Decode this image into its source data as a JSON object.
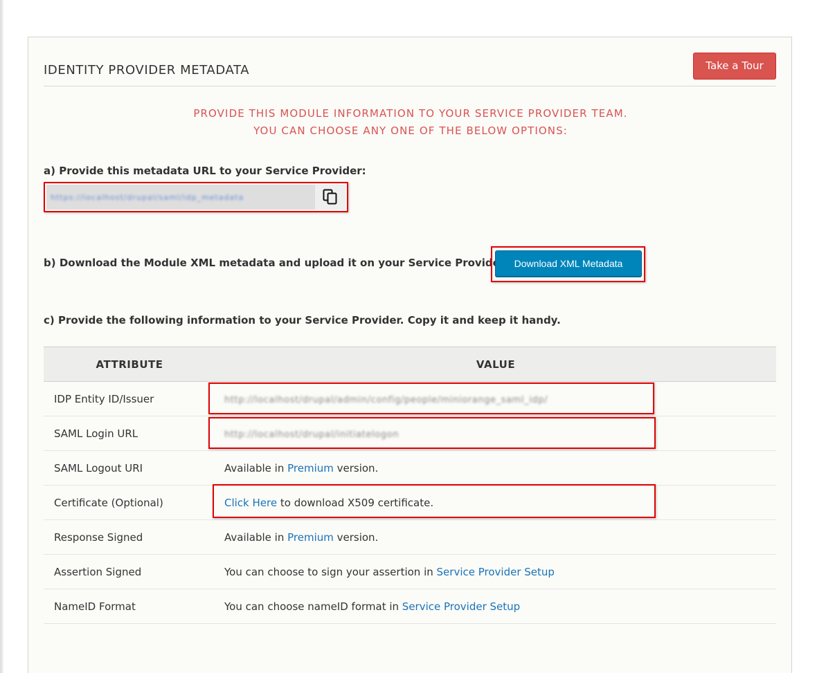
{
  "panel": {
    "title": "IDENTITY PROVIDER METADATA",
    "tour_button": "Take a Tour"
  },
  "notice": {
    "line1": "PROVIDE THIS MODULE INFORMATION TO YOUR SERVICE PROVIDER TEAM.",
    "line2": "YOU CAN CHOOSE ANY ONE OF THE BELOW OPTIONS:"
  },
  "option_a": {
    "label": "a) Provide this metadata URL to your Service Provider:",
    "url_value": "https://localhost/drupal/saml/idp_metadata",
    "copy_icon": "copy-icon"
  },
  "option_b": {
    "label": "b) Download the Module XML metadata and upload it on your Service Provider :",
    "button": "Download XML Metadata"
  },
  "option_c": {
    "label": "c) Provide the following information to your Service Provider. Copy it and keep it handy."
  },
  "table": {
    "headers": [
      "ATTRIBUTE",
      "VALUE"
    ],
    "rows": [
      {
        "attribute": "IDP Entity ID/Issuer",
        "value": "http://localhost/drupal/admin/config/people/miniorange_saml_idp/"
      },
      {
        "attribute": "SAML Login URL",
        "value": "http://localhost/drupal/initiatelogon"
      },
      {
        "attribute": "SAML Logout URI",
        "prefix": "Available in ",
        "link": "Premium",
        "suffix": " version."
      },
      {
        "attribute": "Certificate (Optional)",
        "link": "Click Here",
        "suffix": " to download X509 certificate."
      },
      {
        "attribute": "Response Signed",
        "prefix": "Available in ",
        "link": "Premium",
        "suffix": " version."
      },
      {
        "attribute": "Assertion Signed",
        "prefix": "You can choose to sign your assertion in ",
        "link": "Service Provider Setup"
      },
      {
        "attribute": "NameID Format",
        "prefix": "You can choose nameID format in ",
        "link": "Service Provider Setup"
      }
    ]
  },
  "colors": {
    "accent_red": "#d9534f",
    "primary_blue": "#0085ba",
    "link_blue": "#1a73b8",
    "highlight_box": "#e00000"
  }
}
